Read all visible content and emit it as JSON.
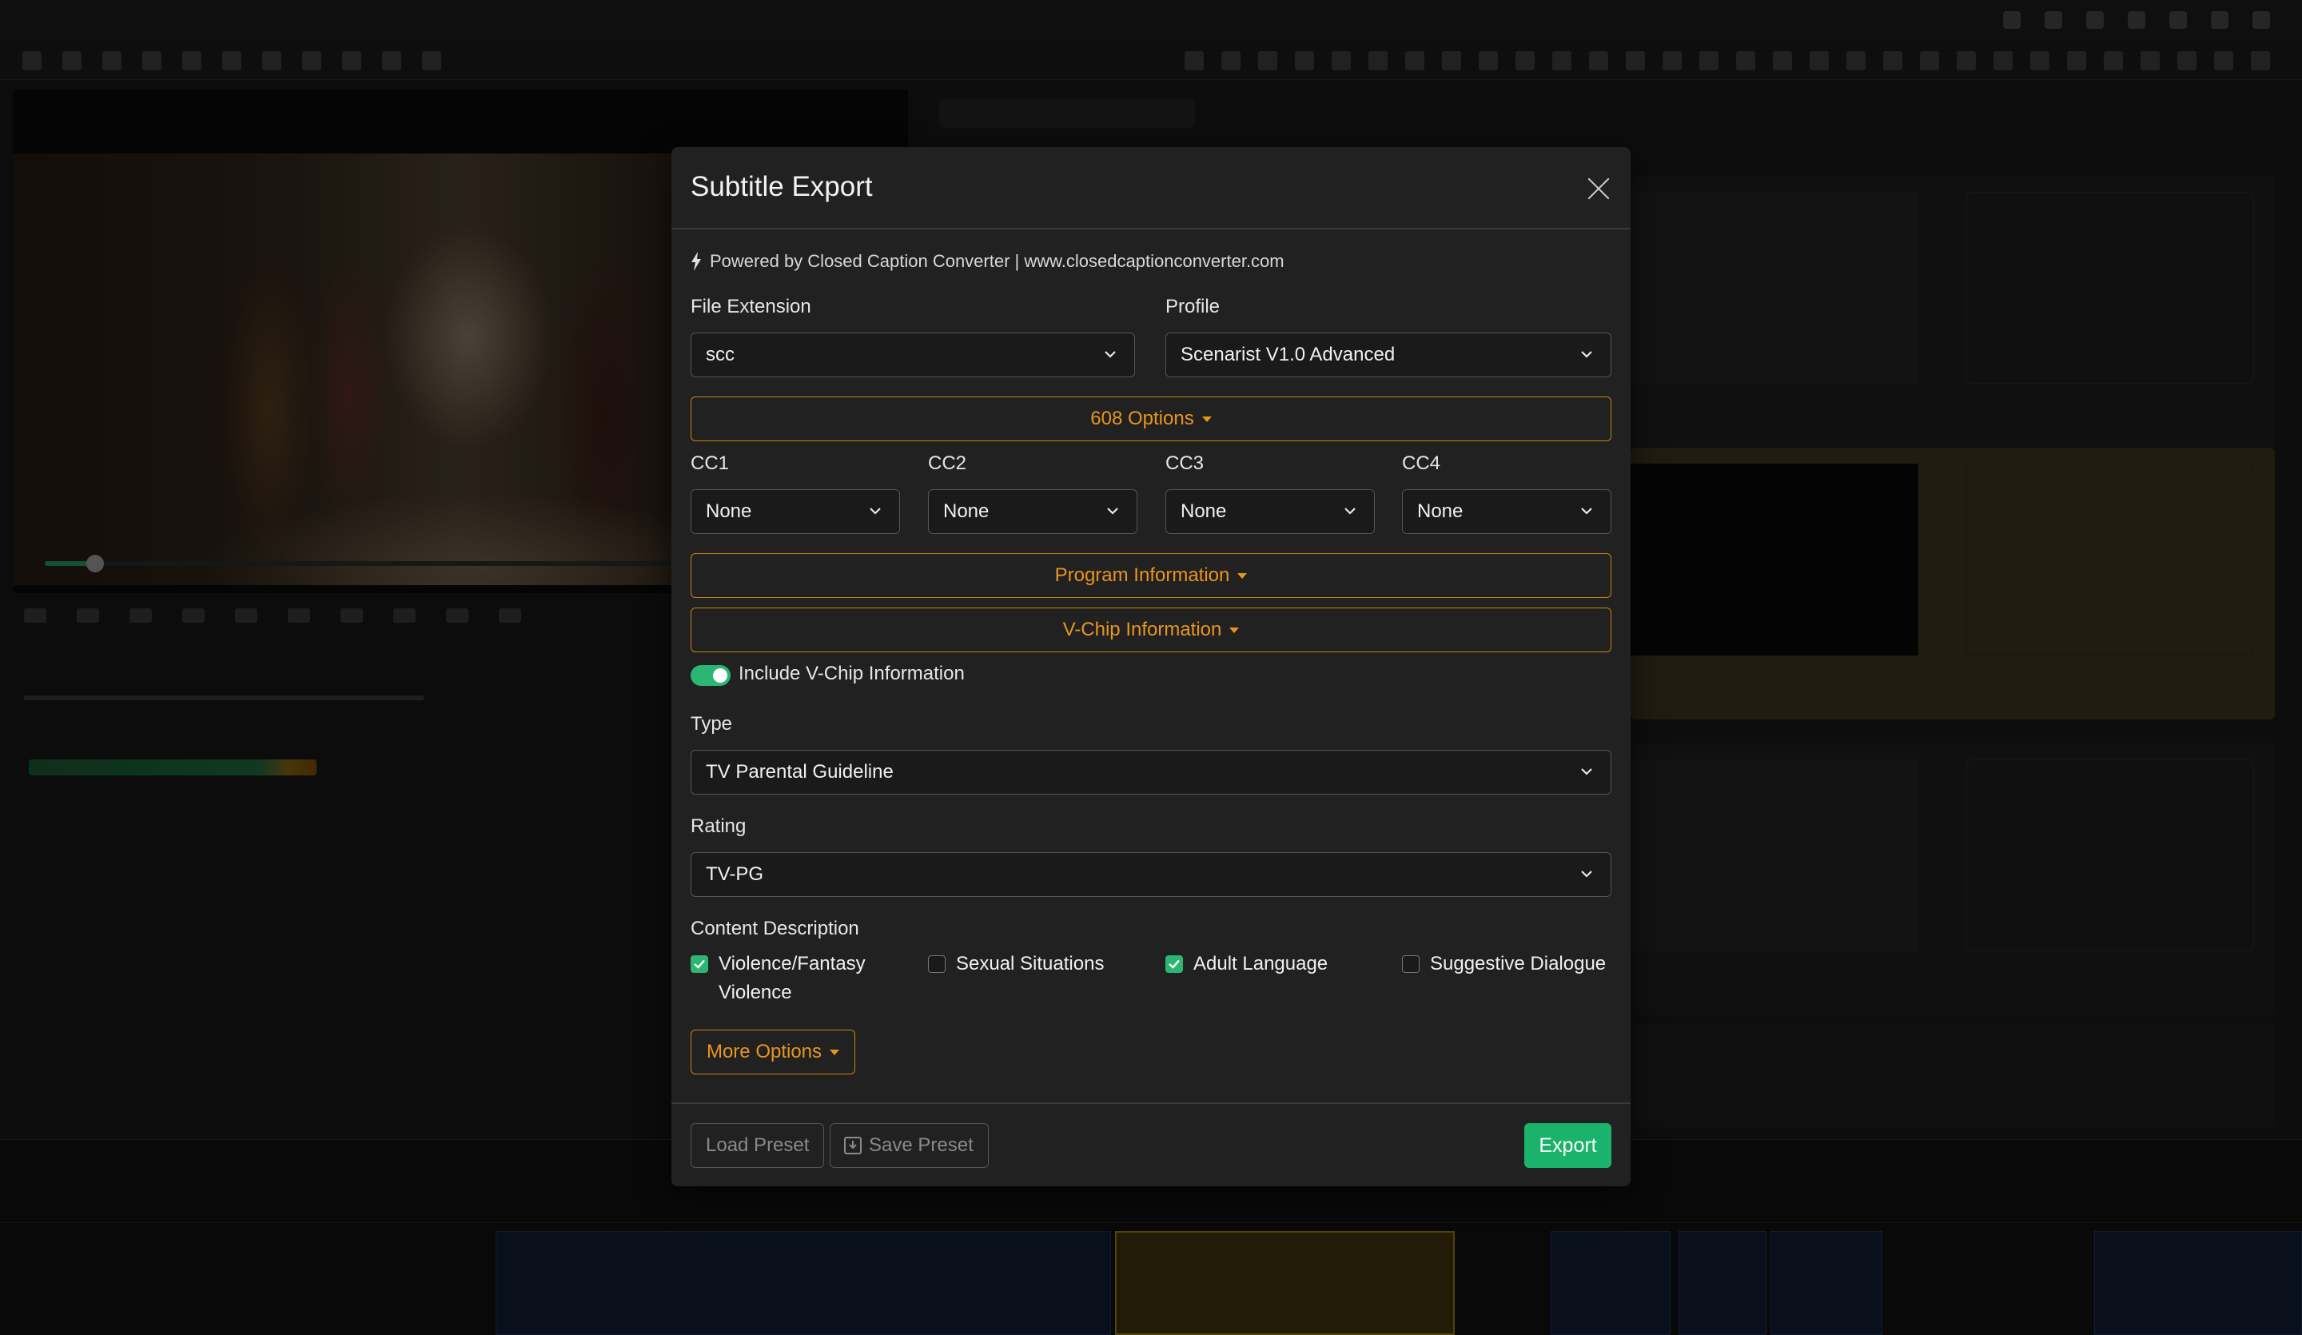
{
  "modal": {
    "title": "Subtitle Export",
    "powered_by": "Powered by Closed Caption Converter | www.closedcaptionconverter.com",
    "file_extension": {
      "label": "File Extension",
      "value": "scc"
    },
    "profile": {
      "label": "Profile",
      "value": "Scenarist V1.0 Advanced"
    },
    "options_608": "608 Options",
    "cc": [
      {
        "label": "CC1",
        "value": "None"
      },
      {
        "label": "CC2",
        "value": "None"
      },
      {
        "label": "CC3",
        "value": "None"
      },
      {
        "label": "CC4",
        "value": "None"
      }
    ],
    "program_information": "Program Information",
    "vchip_information": "V-Chip Information",
    "include_vchip": {
      "label": "Include V-Chip Information",
      "checked": true
    },
    "type": {
      "label": "Type",
      "value": "TV Parental Guideline"
    },
    "rating": {
      "label": "Rating",
      "value": "TV-PG"
    },
    "content_description": {
      "label": "Content Description",
      "items": [
        {
          "line1": "Violence/Fantasy",
          "line2": "Violence",
          "checked": true
        },
        {
          "line1": "Sexual Situations",
          "line2": "",
          "checked": false
        },
        {
          "line1": "Adult Language",
          "line2": "",
          "checked": true
        },
        {
          "line1": "Suggestive Dialogue",
          "line2": "",
          "checked": false
        }
      ]
    },
    "more_options": "More Options",
    "footer": {
      "load_preset": "Load Preset",
      "save_preset": "Save Preset",
      "export": "Export"
    }
  },
  "colors": {
    "accent_orange": "#e8951f",
    "accent_green": "#19b36b",
    "modal_bg": "#212121"
  },
  "icons": [
    "bolt-icon",
    "close-icon",
    "chevron-down-icon",
    "checkmark-icon",
    "save-icon"
  ]
}
